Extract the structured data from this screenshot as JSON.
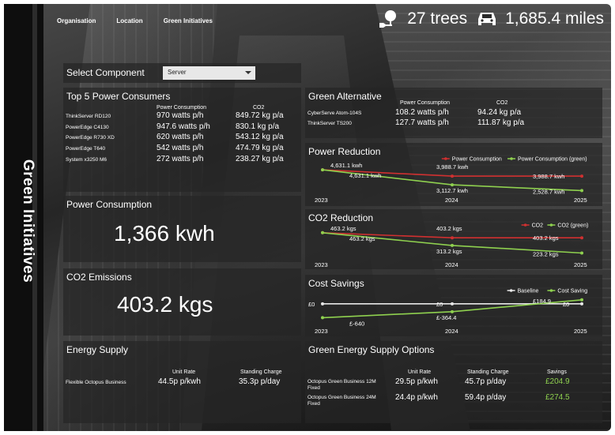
{
  "nav": {
    "items": [
      "Organisation",
      "Location",
      "Green Initiatives"
    ]
  },
  "stats": {
    "trees": "27 trees",
    "miles": "1,685.4 miles"
  },
  "sidebar": {
    "title": "Green Initiatives"
  },
  "select": {
    "label": "Select Component",
    "value": "Server"
  },
  "top5": {
    "title": "Top 5 Power Consumers",
    "headers": [
      "Power Consumption",
      "CO2"
    ],
    "rows": [
      {
        "name": "ThinkServer RD120",
        "power": "970 watts p/h",
        "co2": "849.72 kg p/a"
      },
      {
        "name": "PowerEdge C4130",
        "power": "947.6 watts p/h",
        "co2": "830.1 kg p/a"
      },
      {
        "name": "PowerEdge R730 XD",
        "power": "620 watts p/h",
        "co2": "543.12 kg p/a"
      },
      {
        "name": "PowerEdge T640",
        "power": "542 watts p/h",
        "co2": "474.79 kg p/a"
      },
      {
        "name": "System x3250 M6",
        "power": "272 watts p/h",
        "co2": "238.27 kg p/a"
      }
    ]
  },
  "green_alt": {
    "title": "Green Alternative",
    "headers": [
      "Power Consumption",
      "CO2"
    ],
    "rows": [
      {
        "name": "CyberServe Atom-104S",
        "power": "108.2 watts p/h",
        "co2": "94.24 kg p/a"
      },
      {
        "name": "ThinkServer TS200",
        "power": "127.7 watts p/h",
        "co2": "111.87 kg p/a"
      }
    ]
  },
  "power_consumption": {
    "title": "Power Consumption",
    "value": "1,366 kwh"
  },
  "co2_emissions": {
    "title": "CO2 Emissions",
    "value": "403.2 kgs"
  },
  "energy_supply": {
    "title": "Energy Supply",
    "headers": [
      "Unit Rate",
      "Standing Charge"
    ],
    "rows": [
      {
        "name": "Flexible Octopus Business",
        "rate": "44.5p p/kwh",
        "charge": "35.3p p/day"
      }
    ]
  },
  "green_supply": {
    "title": "Green Energy Supply Options",
    "headers": [
      "Unit Rate",
      "Standing Charge",
      "Savings"
    ],
    "rows": [
      {
        "name": "Octopus Green Business 12M Fixed",
        "rate": "29.5p p/kwh",
        "charge": "45.7p p/day",
        "savings": "£204.9"
      },
      {
        "name": "Octopus Green Business 24M Fixed",
        "rate": "24.4p p/kwh",
        "charge": "59.4p p/day",
        "savings": "£274.5"
      }
    ]
  },
  "colors": {
    "red": "#d03030",
    "green": "#8fd14f",
    "white": "#e8e8e8",
    "savings_green": "#8fd14f"
  },
  "chart_data": [
    {
      "type": "line",
      "title": "Power Reduction",
      "x": [
        "2023",
        "2024",
        "2025"
      ],
      "series": [
        {
          "name": "Power Consumption",
          "values": [
            4631.1,
            3988.7,
            3988.7
          ],
          "labels": [
            "4,631.1 kwh",
            "3,988.7 kwh",
            "3,988.7 kwh"
          ]
        },
        {
          "name": "Power Consumption (green)",
          "values": [
            4631.1,
            3112.7,
            2528.7
          ],
          "labels": [
            "4,631.1 kwh",
            "3,112.7 kwh",
            "2,528.7 kwh"
          ]
        }
      ],
      "ylim": [
        2400,
        4800
      ],
      "legend": "top-right"
    },
    {
      "type": "line",
      "title": "CO2 Reduction",
      "x": [
        "2023",
        "2024",
        "2025"
      ],
      "series": [
        {
          "name": "CO2",
          "values": [
            463.2,
            403.2,
            403.2
          ],
          "labels": [
            "463.2 kgs",
            "403.2 kgs",
            "403.2 kgs"
          ]
        },
        {
          "name": "CO2 (green)",
          "values": [
            463.2,
            313.2,
            223.2
          ],
          "labels": [
            "463.2 kgs",
            "313.2 kgs",
            "223.2 kgs"
          ]
        }
      ],
      "ylim": [
        200,
        480
      ],
      "legend": "top-right"
    },
    {
      "type": "line",
      "title": "Cost Savings",
      "x": [
        "2023",
        "2024",
        "2025"
      ],
      "series": [
        {
          "name": "Baseline",
          "values": [
            0,
            0,
            0
          ],
          "labels": [
            "£0",
            "£0",
            "£0"
          ]
        },
        {
          "name": "Cost Saving",
          "values": [
            -640,
            -364.4,
            184.9
          ],
          "labels": [
            "£-640",
            "£-364.4",
            "£184.9"
          ]
        }
      ],
      "ylim": [
        -700,
        250
      ],
      "legend": "top-right"
    }
  ]
}
